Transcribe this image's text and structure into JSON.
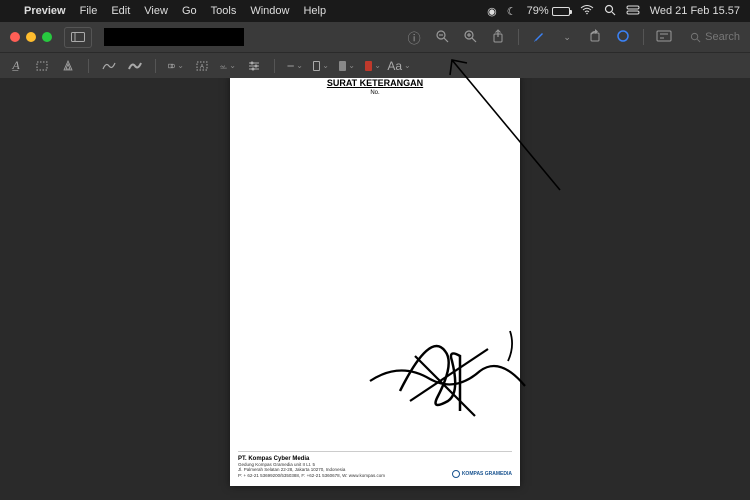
{
  "menubar": {
    "app_name": "Preview",
    "items": [
      "File",
      "Edit",
      "View",
      "Go",
      "Tools",
      "Window",
      "Help"
    ],
    "battery_pct": "79%",
    "datetime": "Wed 21 Feb  15.57"
  },
  "titlebar": {
    "search_placeholder": "Search"
  },
  "document": {
    "title": "SURAT KETERANGAN",
    "subtitle_partial": "No.",
    "company_name": "PT. Kompas Cyber Media",
    "address_line1": "Gedung Kompas Gramedia unit II Lt. 5",
    "address_line2": "Jl. Palmerah Selatan 22-28, Jakarta 10270, Indonesia",
    "address_line3": "P: + 62-21 53699200/5350388, F: +62-21 5360678, W: www.kompas.com",
    "logo_text": "KOMPAS GRAMEDIA"
  },
  "markup_tools": {
    "text_label": "Aa"
  }
}
